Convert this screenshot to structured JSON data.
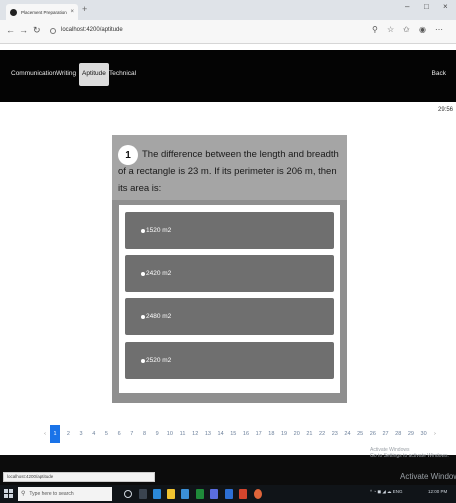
{
  "browser": {
    "tab_title": "Placement Preparation",
    "tab_close": "×",
    "new_tab": "+",
    "window_min": "–",
    "window_max": "□",
    "window_close": "×",
    "url": "localhost:4200/aptitude"
  },
  "nav": {
    "links": [
      "Communication",
      "Writing",
      "Aptitude",
      "Technical"
    ],
    "back": "Back"
  },
  "timer": "29:56",
  "question": {
    "number": "1",
    "text": "The difference between the length and breadth of a rectangle is 23 m. If its perimeter is 206 m, then its area is:",
    "options": [
      "1520 m2",
      "2420 m2",
      "2480 m2",
      "2520 m2"
    ]
  },
  "pagination": {
    "prev": "‹",
    "pages": [
      "1",
      "2",
      "3",
      "4",
      "5",
      "6",
      "7",
      "8",
      "9",
      "10",
      "11",
      "12",
      "13",
      "14",
      "15",
      "16",
      "17",
      "18",
      "19",
      "20",
      "21",
      "22",
      "23",
      "24",
      "25",
      "26",
      "27",
      "28",
      "29",
      "30"
    ],
    "next": "›",
    "active_index": 0
  },
  "status": {
    "link_preview": "localhost:4200/aptitude"
  },
  "watermark": {
    "small_title": "Activate Windows",
    "small_sub": "Go to Settings to activate Windows.",
    "big": "Activate Windows"
  },
  "taskbar": {
    "search_placeholder": "Type here to search",
    "clock": "12:00 PM"
  },
  "colors": {
    "nav_bg": "#040404",
    "card_bg": "#8f8f8f",
    "option_bg": "#6f6f6f",
    "active_page": "#1a73e8"
  }
}
